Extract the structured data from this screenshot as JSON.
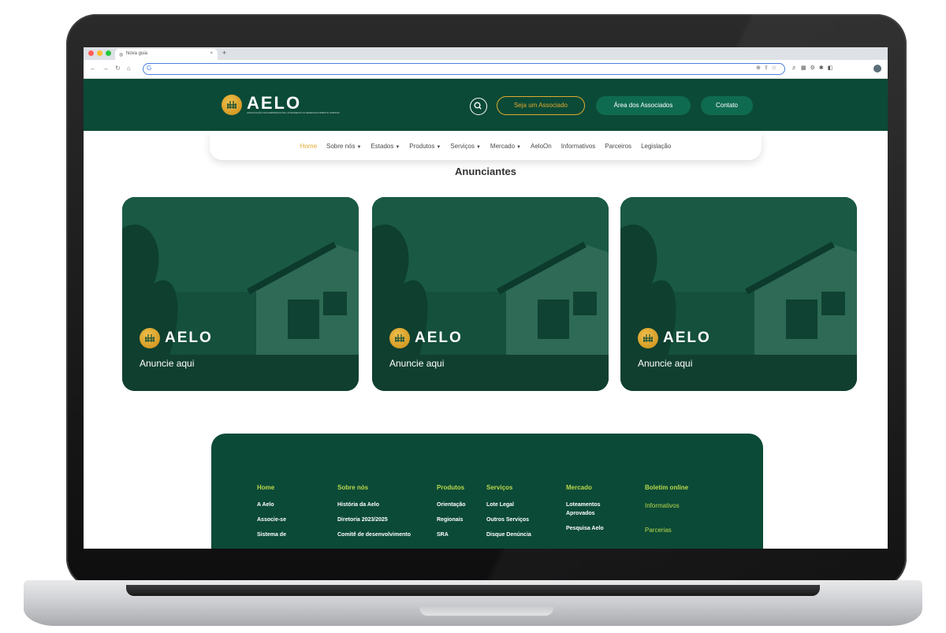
{
  "browser": {
    "tab_title": "Nova guia",
    "new_tab": "+",
    "omnibox_prefix": "G"
  },
  "brand": {
    "name": "AELO",
    "tagline": "ASSOCIAÇÃO DAS EMPRESAS DE LOTEAMENTO E DESENVOLVIMENTO URBANO",
    "colors": {
      "primary": "#0b4a37",
      "accent": "#e0a92e",
      "lime": "#b9d84b"
    }
  },
  "header": {
    "search_icon": "search-icon",
    "btn_join": "Seja um Associado",
    "btn_area": "Área dos Associados",
    "btn_contact": "Contato"
  },
  "menu": {
    "items": [
      {
        "label": "Home",
        "dropdown": false
      },
      {
        "label": "Sobre nós",
        "dropdown": true
      },
      {
        "label": "Estados",
        "dropdown": true
      },
      {
        "label": "Produtos",
        "dropdown": true
      },
      {
        "label": "Serviços",
        "dropdown": true
      },
      {
        "label": "Mercado",
        "dropdown": true
      },
      {
        "label": "AeloOn",
        "dropdown": false
      },
      {
        "label": "Informativos",
        "dropdown": false
      },
      {
        "label": "Parceiros",
        "dropdown": false
      },
      {
        "label": "Legislação",
        "dropdown": false
      }
    ]
  },
  "main": {
    "section_title": "Anunciantes",
    "cards": [
      {
        "logo": "AELO",
        "cta": "Anuncie aqui"
      },
      {
        "logo": "AELO",
        "cta": "Anuncie aqui"
      },
      {
        "logo": "AELO",
        "cta": "Anuncie aqui"
      }
    ]
  },
  "footer": {
    "columns": [
      {
        "heading": "Home",
        "links": [
          "A Aelo",
          "Associe-se",
          "Sistema de"
        ]
      },
      {
        "heading": "Sobre nós",
        "links": [
          "História da Aelo",
          "Diretoria 2023/2025",
          "Comitê de desenvolvimento"
        ]
      },
      {
        "heading": "Produtos",
        "links": [
          "Orientação",
          "Regionais",
          "SRA"
        ]
      },
      {
        "heading": "Serviços",
        "links": [
          "Lote Legal",
          "Outros Serviços",
          "Disque Denúncia"
        ]
      },
      {
        "heading": "Mercado",
        "links": [
          "Loteamentos",
          "Aprovados",
          "Pesquisa Aelo"
        ]
      },
      {
        "heading": "Boletim online",
        "links": [
          "Informativos",
          "Parcerias"
        ]
      }
    ]
  }
}
